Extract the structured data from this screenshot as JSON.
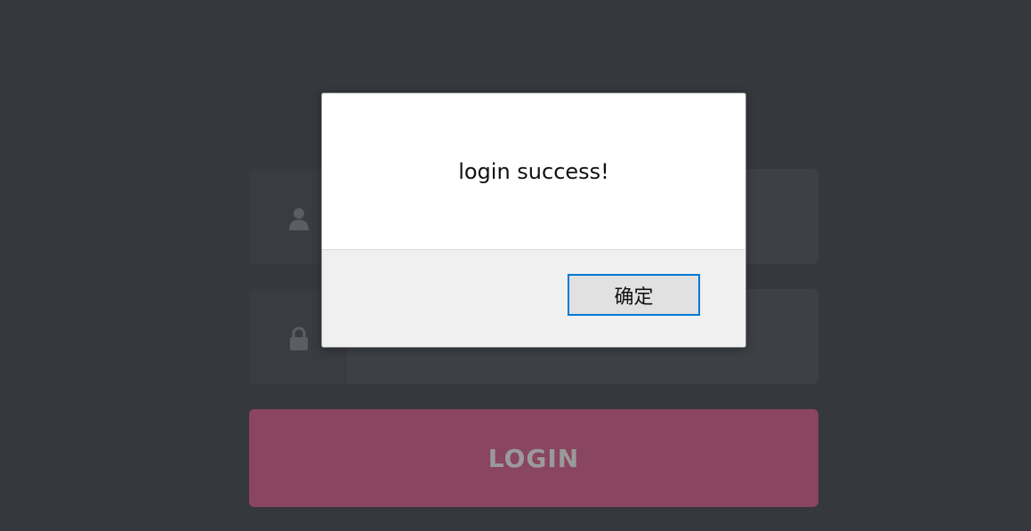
{
  "login_form": {
    "username_icon": "user-icon",
    "password_icon": "lock-icon",
    "username_value": "",
    "password_value": "",
    "login_label": "LOGIN"
  },
  "alert": {
    "message": "login success!",
    "ok_label": "确定"
  },
  "colors": {
    "background": "#35383c",
    "login_button": "#8a4560",
    "dialog_focus_border": "#0078d7"
  }
}
